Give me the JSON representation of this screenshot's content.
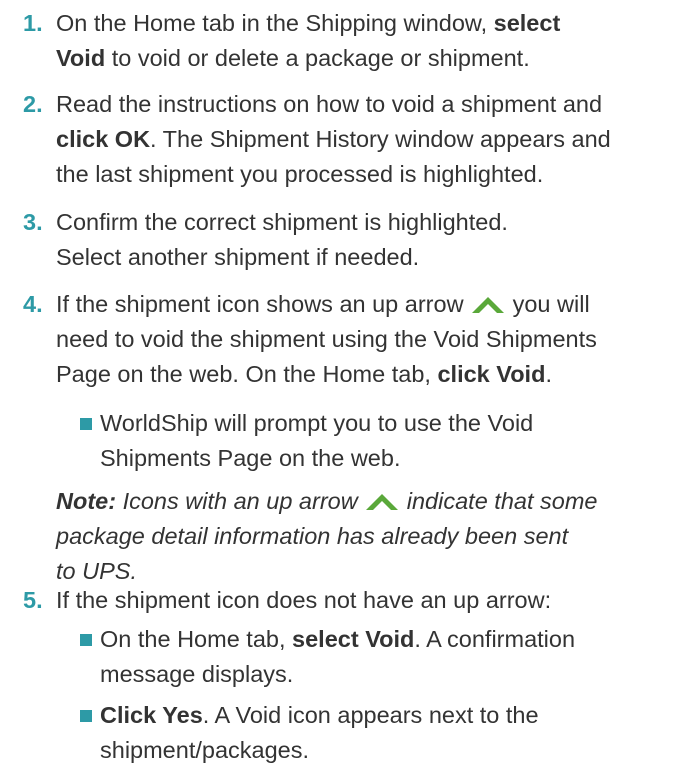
{
  "steps": [
    {
      "num": "1.",
      "l1a": "On the Home tab in the Shipping window, ",
      "l1b": "select",
      "l2a": "Void",
      "l2b": " to void or delete a package or shipment."
    },
    {
      "num": "2.",
      "l1": "Read the instructions on how to void a shipment and",
      "l2a": "click OK",
      "l2b": ". The Shipment History window appears and",
      "l3": "the last shipment you processed is highlighted."
    },
    {
      "num": "3.",
      "l1": "Confirm the correct shipment is highlighted.",
      "l2": "Select another shipment if needed."
    },
    {
      "num": "4.",
      "l1a": "If the shipment icon shows an up arrow",
      "l1b": " you will",
      "l2": "need to void the shipment using the Void Shipments",
      "l3a": "Page on the web. On the Home tab, ",
      "l3b": "click Void",
      "l3c": "."
    },
    {
      "num": "5.",
      "l1": "If the shipment icon does not have an up arrow:"
    }
  ],
  "step4_bullet": {
    "l1": "WorldShip will prompt you to use the Void",
    "l2": "Shipments Page on the web."
  },
  "note": {
    "label": "Note:",
    "l1a": " Icons with an up arrow",
    "l1b": " indicate that some",
    "l2": "package detail information has already been sent",
    "l3": "to UPS."
  },
  "step5_bullets": [
    {
      "l1a": "On the Home tab, ",
      "l1b": "select Void",
      "l1c": ". A confirmation",
      "l2": "message displays."
    },
    {
      "l1a": "Click Yes",
      "l1b": ". A Void icon appears next to the",
      "l2": "shipment/packages."
    }
  ],
  "colors": {
    "accent": "#2d9aa6",
    "text": "#333333",
    "arrow": "#5aa83a"
  },
  "icons": {
    "arrow": "up-arrow-icon"
  }
}
